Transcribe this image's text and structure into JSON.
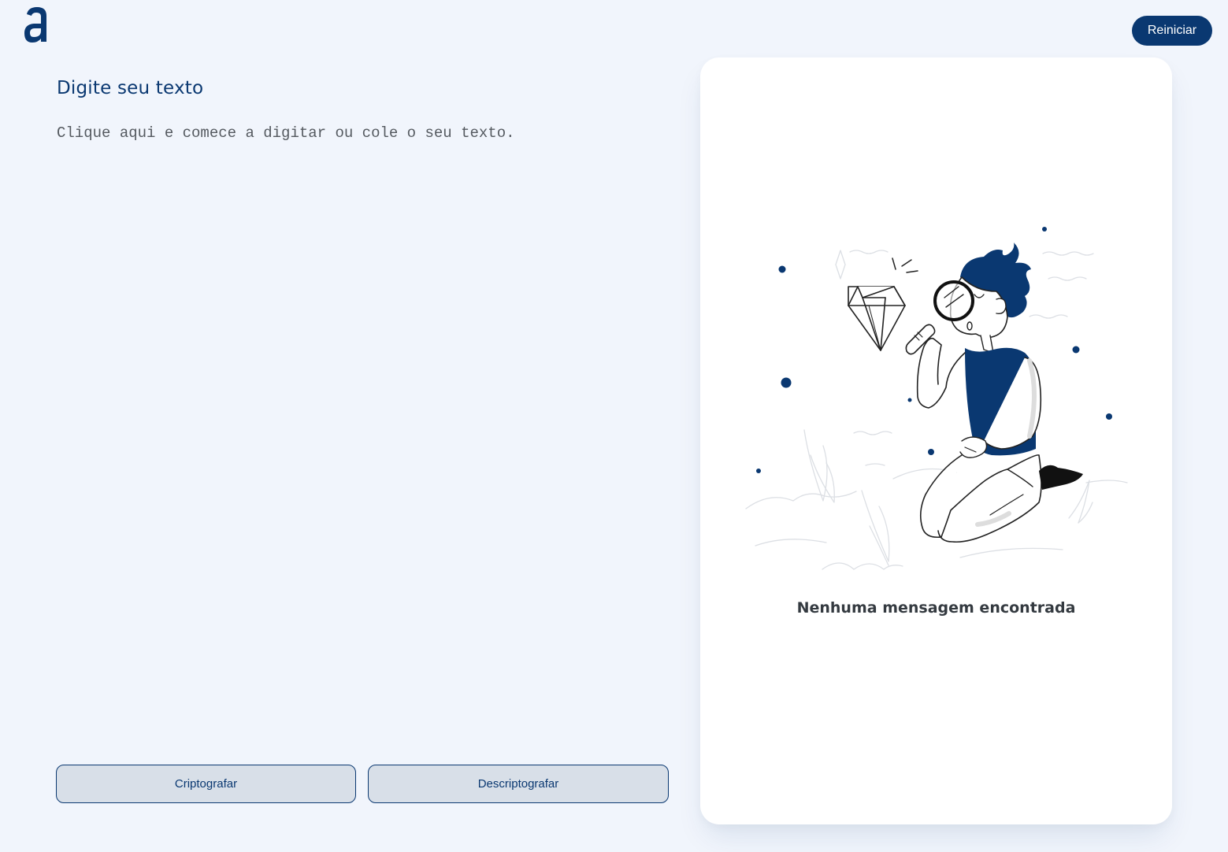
{
  "header": {
    "logo_alt": "a",
    "reset_label": "Reiniciar"
  },
  "input": {
    "title": "Digite seu texto",
    "placeholder": "Clique aqui e comece a digitar ou cole o seu texto."
  },
  "actions": {
    "encrypt_label": "Criptografar",
    "decrypt_label": "Descriptografar"
  },
  "output": {
    "empty_message": "Nenhuma mensagem encontrada"
  },
  "colors": {
    "accent": "#0a3871",
    "background": "#f1f5fc",
    "card": "#ffffff",
    "button_bg": "#d8dfe8"
  },
  "icons": {
    "logo": "alura-a-logo-icon",
    "illustration": "person-with-magnifier-and-diamond-illustration"
  }
}
